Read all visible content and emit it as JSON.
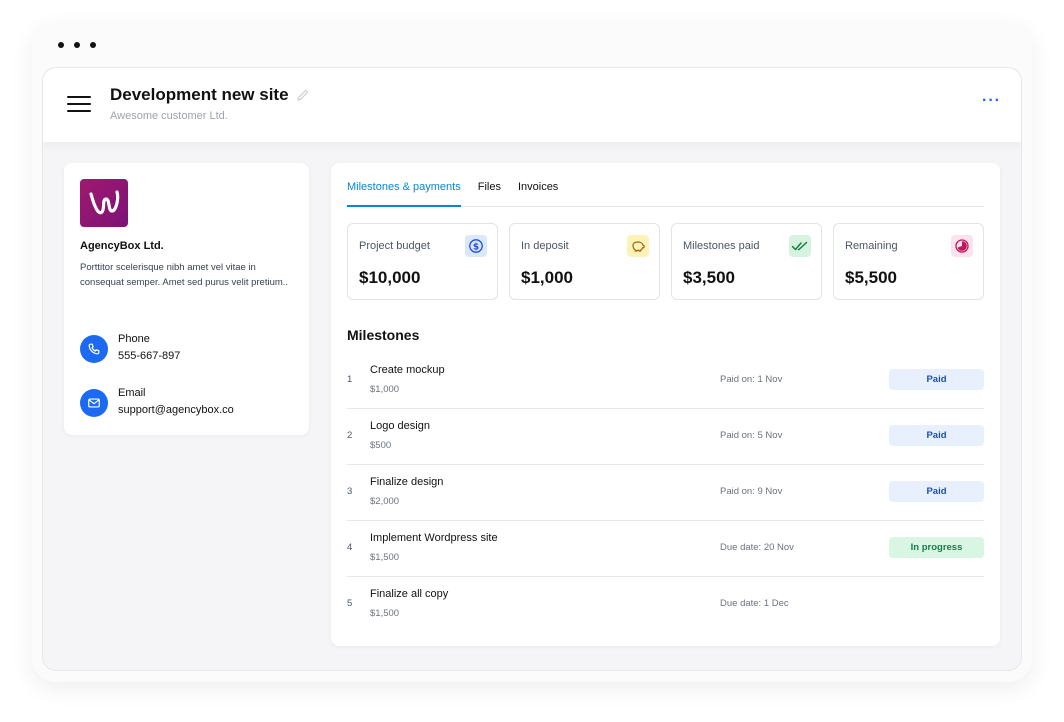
{
  "header": {
    "title": "Development new site",
    "subtitle": "Awesome customer Ltd.",
    "more_label": "···"
  },
  "company": {
    "name": "AgencyBox Ltd.",
    "description": "Porttitor scelerisque nibh amet vel vitae in consequat semper. Amet sed purus velit pretium..",
    "phone_label": "Phone",
    "phone": "555-667-897",
    "email_label": "Email",
    "email": "support@agencybox.co"
  },
  "tabs": [
    {
      "label": "Milestones & payments",
      "active": true
    },
    {
      "label": "Files",
      "active": false
    },
    {
      "label": "Invoices",
      "active": false
    }
  ],
  "stats": [
    {
      "label": "Project budget",
      "value": "$10,000",
      "icon": "dollar-icon",
      "icon_bg": "#dbe7fb",
      "icon_color": "#1d4ed8"
    },
    {
      "label": "In deposit",
      "value": "$1,000",
      "icon": "piggy-bank-icon",
      "icon_bg": "#fdf3b8",
      "icon_color": "#a16207"
    },
    {
      "label": "Milestones paid",
      "value": "$3,500",
      "icon": "double-check-icon",
      "icon_bg": "#d5f3df",
      "icon_color": "#15803d"
    },
    {
      "label": "Remaining",
      "value": "$5,500",
      "icon": "pie-icon",
      "icon_bg": "#fbe3ee",
      "icon_color": "#be185d"
    }
  ],
  "milestones": {
    "title": "Milestones",
    "items": [
      {
        "num": "1",
        "name": "Create mockup",
        "amount": "$1,000",
        "date": "Paid on: 1 Nov",
        "status": "Paid"
      },
      {
        "num": "2",
        "name": "Logo design",
        "amount": "$500",
        "date": "Paid on: 5 Nov",
        "status": "Paid"
      },
      {
        "num": "3",
        "name": "Finalize design",
        "amount": "$2,000",
        "date": "Paid on: 9 Nov",
        "status": "Paid"
      },
      {
        "num": "4",
        "name": "Implement Wordpress site",
        "amount": "$1,500",
        "date": "Due date: 20 Nov",
        "status": "In progress"
      },
      {
        "num": "5",
        "name": "Finalize all copy",
        "amount": "$1,500",
        "date": "Due date: 1 Dec",
        "status": ""
      }
    ]
  }
}
